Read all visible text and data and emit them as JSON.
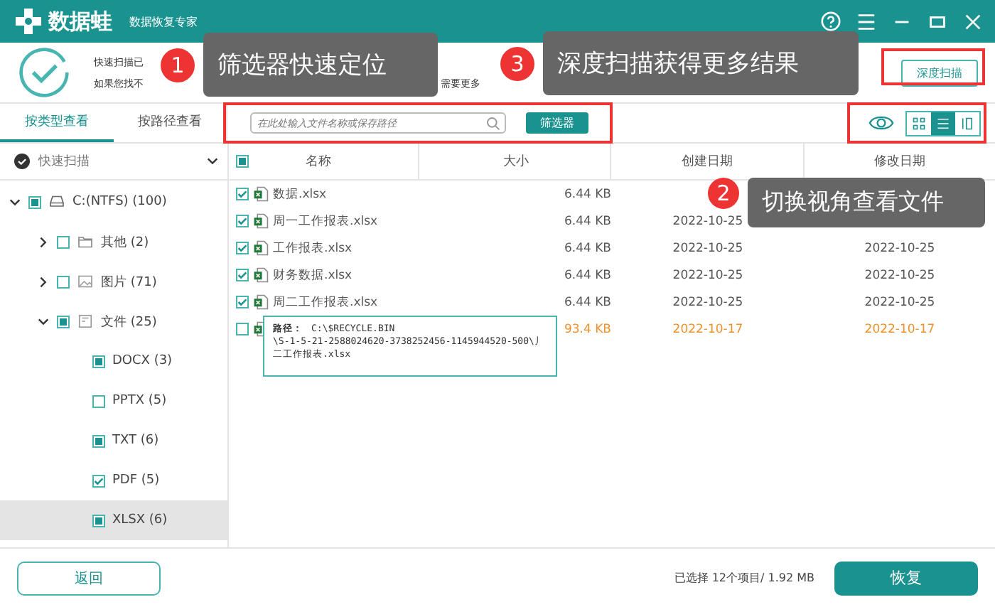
{
  "window": {
    "app_name": "数据蛙",
    "subtitle": "数据恢复专家"
  },
  "header": {
    "info_fragments": [
      "快速扫描已",
      "如果您找不",
      "需要更多"
    ],
    "deep_scan_button": "深度扫描"
  },
  "view_tabs": [
    {
      "label": "按类型查看",
      "selected": true
    },
    {
      "label": "按路径查看",
      "selected": false
    }
  ],
  "search": {
    "placeholder": "在此处输入文件名称或保存路径"
  },
  "filter_button": "筛选器",
  "view_modes": [
    {
      "kind": "grid",
      "selected": false
    },
    {
      "kind": "list",
      "selected": true
    },
    {
      "kind": "columns",
      "selected": false
    }
  ],
  "scan_mode": "快速扫描",
  "tree": [
    {
      "label": "C:(NTFS) (100)",
      "kind": "drive",
      "checked": true,
      "partial": true,
      "expanded": true,
      "selected": false,
      "children": [
        {
          "label": "其他 (2)",
          "kind": "folder",
          "checked": false,
          "expanded": false,
          "selected": false
        },
        {
          "label": "图片 (71)",
          "kind": "image",
          "checked": false,
          "expanded": false,
          "selected": false
        },
        {
          "label": "文件 (25)",
          "kind": "document",
          "checked": true,
          "partial": true,
          "expanded": true,
          "selected": false,
          "children": [
            {
              "label": "DOCX (3)",
              "checked": true,
              "partial": true,
              "selected": false
            },
            {
              "label": "PPTX (5)",
              "checked": false,
              "selected": false
            },
            {
              "label": "TXT (6)",
              "checked": true,
              "partial": true,
              "selected": false
            },
            {
              "label": "PDF (5)",
              "checked": true,
              "partial": false,
              "selected": false
            },
            {
              "label": "XLSX (6)",
              "checked": true,
              "partial": true,
              "selected": true
            }
          ]
        }
      ]
    }
  ],
  "table": {
    "header_checked": true,
    "header_partial": true,
    "columns": [
      "名称",
      "大小",
      "创建日期",
      "修改日期"
    ],
    "rows": [
      {
        "name": "数据.xlsx",
        "size": "6.44 KB",
        "checked": true,
        "color": "#555555"
      },
      {
        "name": "周一工作报表.xlsx",
        "size": "6.44 KB",
        "created": "2022-10-25",
        "checked": true,
        "color": "#555555"
      },
      {
        "name": "工作报表.xlsx",
        "size": "6.44 KB",
        "created": "2022-10-25",
        "modified": "2022-10-25",
        "checked": true,
        "color": "#555555"
      },
      {
        "name": "财务数据.xlsx",
        "size": "6.44 KB",
        "created": "2022-10-25",
        "modified": "2022-10-25",
        "checked": true,
        "color": "#555555"
      },
      {
        "name": "周二工作报表.xlsx",
        "size": "6.44 KB",
        "created": "2022-10-25",
        "modified": "2022-10-25",
        "checked": true,
        "color": "#555555"
      },
      {
        "size": "93.4 KB",
        "created": "2022-10-17",
        "modified": "2022-10-17",
        "checked": false,
        "color": "#f0922b"
      }
    ]
  },
  "tooltip": {
    "label": "路径：",
    "lines": [
      "C:\\$RECYCLE.BIN",
      "\\S-1-5-21-2588024620-3738252456-1145944520-500\\丿",
      "二工作报表.xlsx"
    ]
  },
  "callouts": [
    {
      "number": "1",
      "text": "筛选器快速定位"
    },
    {
      "number": "3",
      "text": "深度扫描获得更多结果"
    },
    {
      "number": "2",
      "text": "切换视角查看文件"
    }
  ],
  "footer": {
    "back_button": "返回",
    "selection": "已选择 12个项目/ 1.92 MB",
    "recover_button": "恢复"
  }
}
